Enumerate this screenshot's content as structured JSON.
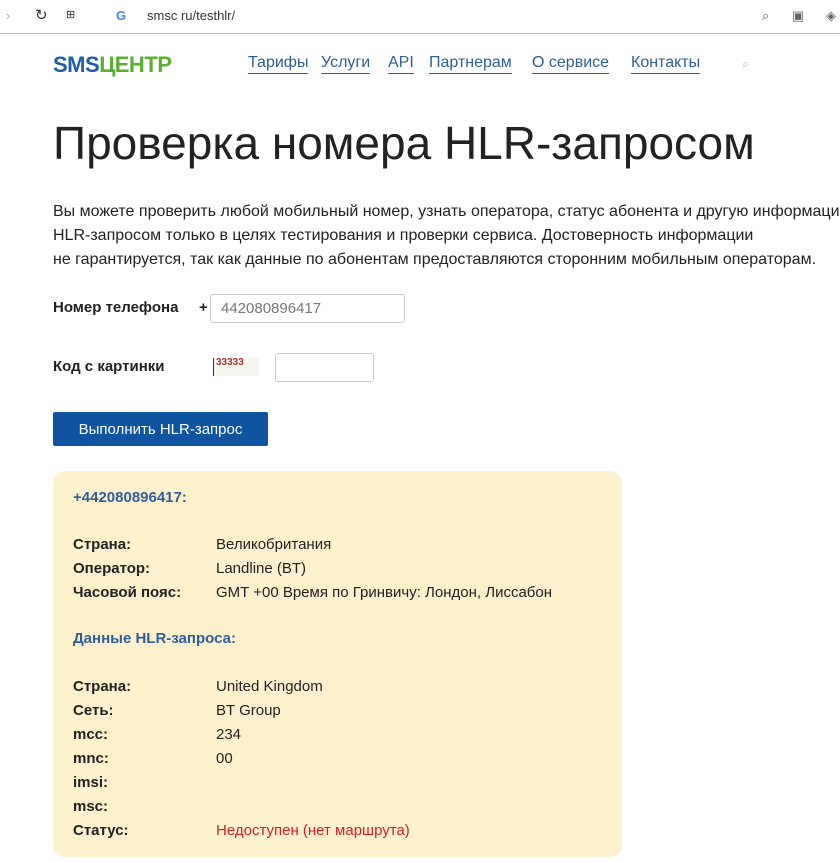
{
  "browser": {
    "url": "smsc ru/testhlr/"
  },
  "logo": {
    "part1": "SMS",
    "part2": "ЦЕНТР"
  },
  "nav": [
    "Тарифы",
    "Услуги",
    "API",
    "Партнерам",
    "О сервисе",
    "Контакты"
  ],
  "title": "Проверка номера HLR-запросом",
  "intro": [
    "Вы можете проверить любой мобильный номер, узнать оператора, статус абонента и другую информацию",
    "HLR-запросом только в целях тестирования и проверки сервиса. Достоверность информации",
    "не гарантируется, так как данные по абонентам предоставляются сторонним мобильным операторам."
  ],
  "form": {
    "phone_label": "Номер телефона",
    "plus": "+",
    "phone_value": "442080896417",
    "captcha_label": "Код с картинки",
    "captcha_text": "33333",
    "captcha_value": "",
    "submit": "Выполнить HLR-запрос"
  },
  "result": {
    "number": "+442080896417:",
    "info": [
      {
        "k": "Страна:",
        "v": "Великобритания"
      },
      {
        "k": "Оператор:",
        "v": "Landline (BT)"
      },
      {
        "k": "Часовой пояс:",
        "v": "GMT +00 Время по Гринвичу: Лондон, Лиссабон"
      }
    ],
    "hlr_title": "Данные HLR-запроса:",
    "hlr": [
      {
        "k": "Страна:",
        "v": "United Kingdom"
      },
      {
        "k": "Сеть:",
        "v": "BT Group"
      },
      {
        "k": "mcc:",
        "v": "234"
      },
      {
        "k": "mnc:",
        "v": "00"
      },
      {
        "k": "imsi:",
        "v": ""
      },
      {
        "k": "msc:",
        "v": ""
      },
      {
        "k": "Статус:",
        "v": "Недоступен (нет маршрута)"
      }
    ]
  }
}
